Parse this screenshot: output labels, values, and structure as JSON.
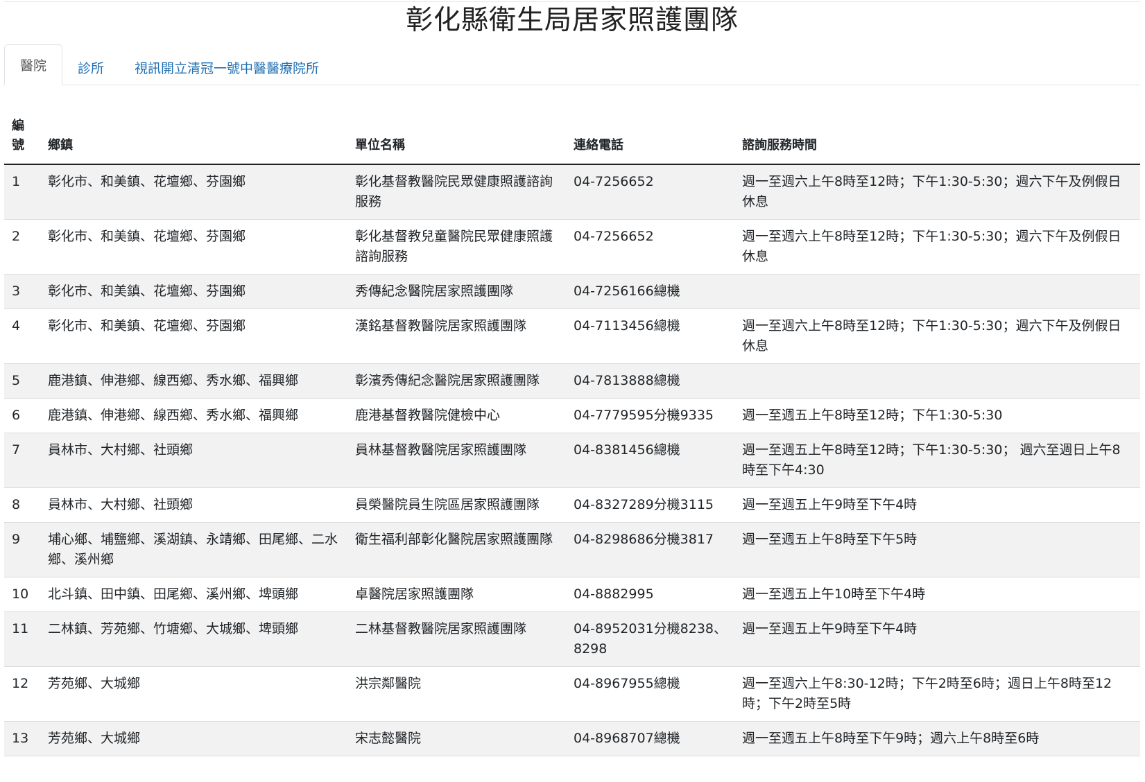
{
  "page": {
    "title": "彰化縣衛生局居家照護團隊"
  },
  "tabs": [
    {
      "label": "醫院"
    },
    {
      "label": "診所"
    },
    {
      "label": "視訊開立清冠一號中醫醫療院所"
    }
  ],
  "table": {
    "headers": [
      "編號",
      "鄉鎮",
      "單位名稱",
      "連絡電話",
      "諮詢服務時間"
    ],
    "rows": [
      {
        "no": "1",
        "towns": "彰化市、和美鎮、花壇鄉、芬園鄉",
        "unit": "彰化基督教醫院民眾健康照護諮詢服務",
        "phone": "04-7256652",
        "hours": "週一至週六上午8時至12時；下午1:30-5:30；週六下午及例假日休息"
      },
      {
        "no": "2",
        "towns": "彰化市、和美鎮、花壇鄉、芬園鄉",
        "unit": "彰化基督教兒童醫院民眾健康照護諮詢服務",
        "phone": "04-7256652",
        "hours": "週一至週六上午8時至12時；下午1:30-5:30；週六下午及例假日休息"
      },
      {
        "no": "3",
        "towns": "彰化市、和美鎮、花壇鄉、芬園鄉",
        "unit": "秀傳紀念醫院居家照護團隊",
        "phone": "04-7256166總機",
        "hours": ""
      },
      {
        "no": "4",
        "towns": "彰化市、和美鎮、花壇鄉、芬園鄉",
        "unit": "漢銘基督教醫院居家照護團隊",
        "phone": "04-7113456總機",
        "hours": "週一至週六上午8時至12時；下午1:30-5:30；週六下午及例假日休息"
      },
      {
        "no": "5",
        "towns": "鹿港鎮、伸港鄉、線西鄉、秀水鄉、福興鄉",
        "unit": "彰濱秀傳紀念醫院居家照護團隊",
        "phone": "04-7813888總機",
        "hours": ""
      },
      {
        "no": "6",
        "towns": "鹿港鎮、伸港鄉、線西鄉、秀水鄉、福興鄉",
        "unit": "鹿港基督教醫院健檢中心",
        "phone": "04-7779595分機9335",
        "hours": "週一至週五上午8時至12時；下午1:30-5:30"
      },
      {
        "no": "7",
        "towns": "員林市、大村鄉、社頭鄉",
        "unit": "員林基督教醫院居家照護團隊",
        "phone": "04-8381456總機",
        "hours": "週一至週五上午8時至12時；下午1:30-5:30； 週六至週日上午8時至下午4:30"
      },
      {
        "no": "8",
        "towns": "員林市、大村鄉、社頭鄉",
        "unit": "員榮醫院員生院區居家照護團隊",
        "phone": "04-8327289分機3115",
        "hours": "週一至週五上午9時至下午4時"
      },
      {
        "no": "9",
        "towns": "埔心鄉、埔鹽鄉、溪湖鎮、永靖鄉、田尾鄉、二水鄉、溪州鄉",
        "unit": "衛生福利部彰化醫院居家照護團隊",
        "phone": "04-8298686分機3817",
        "hours": "週一至週五上午8時至下午5時"
      },
      {
        "no": "10",
        "towns": "北斗鎮、田中鎮、田尾鄉、溪州鄉、埤頭鄉",
        "unit": "卓醫院居家照護團隊",
        "phone": "04-8882995",
        "hours": "週一至週五上午10時至下午4時"
      },
      {
        "no": "11",
        "towns": "二林鎮、芳苑鄉、竹塘鄉、大城鄉、埤頭鄉",
        "unit": "二林基督教醫院居家照護團隊",
        "phone": "04-8952031分機8238、8298",
        "hours": "週一至週五上午9時至下午4時"
      },
      {
        "no": "12",
        "towns": "芳苑鄉、大城鄉",
        "unit": "洪宗鄰醫院",
        "phone": "04-8967955總機",
        "hours": "週一至週六上午8:30-12時；下午2時至6時；週日上午8時至12時；下午2時至5時"
      },
      {
        "no": "13",
        "towns": "芳苑鄉、大城鄉",
        "unit": "宋志懿醫院",
        "phone": "04-8968707總機",
        "hours": "週一至週五上午8時至下午9時；週六上午8時至6時"
      }
    ]
  }
}
